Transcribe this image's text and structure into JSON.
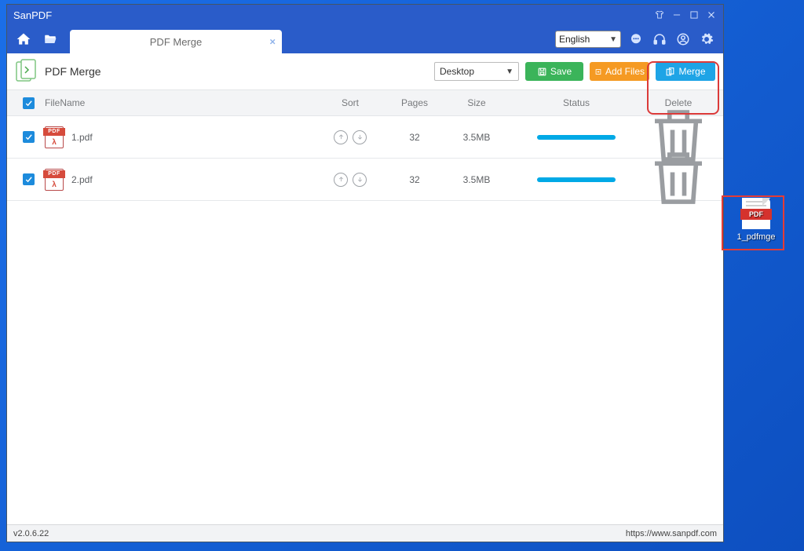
{
  "window": {
    "title": "SanPDF"
  },
  "toolbar": {
    "tab_label": "PDF Merge",
    "language": "English"
  },
  "page": {
    "title": "PDF Merge",
    "destination": "Desktop",
    "save_label": "Save",
    "add_label": "Add Files",
    "merge_label": "Merge"
  },
  "columns": {
    "filename": "FileName",
    "sort": "Sort",
    "pages": "Pages",
    "size": "Size",
    "status": "Status",
    "delete": "Delete"
  },
  "files": [
    {
      "name": "1.pdf",
      "pages": "32",
      "size": "3.5MB"
    },
    {
      "name": "2.pdf",
      "pages": "32",
      "size": "3.5MB"
    }
  ],
  "statusbar": {
    "version": "v2.0.6.22",
    "url": "https://www.sanpdf.com"
  },
  "desktop_file": {
    "label": "1_pdfmge",
    "band": "PDF"
  },
  "pdf_band": "PDF"
}
